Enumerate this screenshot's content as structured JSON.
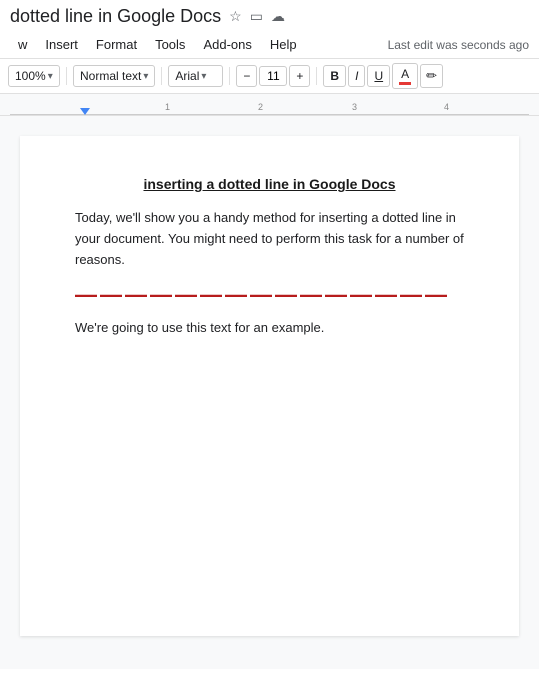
{
  "title_bar": {
    "doc_title": "dotted line in Google Docs",
    "star_icon": "☆",
    "folder_icon": "▭",
    "cloud_icon": "☁"
  },
  "menu_bar": {
    "items": [
      "w",
      "Insert",
      "Format",
      "Tools",
      "Add-ons",
      "Help"
    ],
    "last_edit": "Last edit was seconds ago"
  },
  "toolbar": {
    "zoom": "100%",
    "zoom_chevron": "▾",
    "style": "Normal text",
    "style_chevron": "▾",
    "font": "Arial",
    "font_chevron": "▾",
    "font_size_decrease": "−",
    "font_size": "11",
    "font_size_increase": "+",
    "bold": "B",
    "italic": "I",
    "underline": "U",
    "font_color": "A",
    "highlighter": "✏"
  },
  "document": {
    "heading": "inserting a dotted line in Google Docs",
    "paragraph1": "Today, we'll show you a handy method for inserting a dotted line in your document. You might need to perform this task for a number of reasons.",
    "dotted_line_dashes": "— — — — — — — — — — — — — — —",
    "paragraph2": "We're going to use this text for an example."
  }
}
